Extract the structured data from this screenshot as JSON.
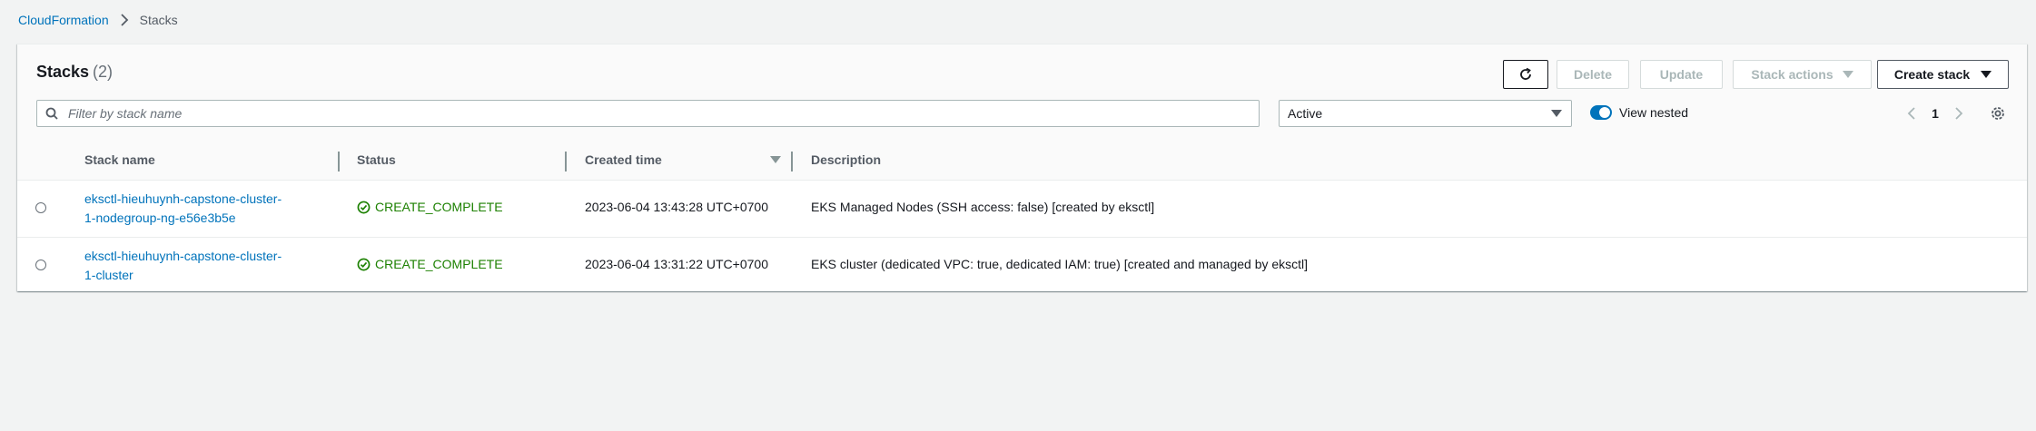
{
  "breadcrumb": {
    "root": "CloudFormation",
    "current": "Stacks"
  },
  "panel": {
    "title": "Stacks",
    "count": "(2)",
    "buttons": {
      "delete": "Delete",
      "update": "Update",
      "stack_actions": "Stack actions",
      "create_stack": "Create stack"
    },
    "search": {
      "placeholder": "Filter by stack name",
      "value": ""
    },
    "filter_select": {
      "selected": "Active"
    },
    "view_nested": {
      "label": "View nested",
      "checked": true
    },
    "pagination": {
      "current_page": "1"
    }
  },
  "table": {
    "columns": [
      "Stack name",
      "Status",
      "Created time",
      "Description"
    ],
    "sort_column": "Created time",
    "sort_direction": "descending",
    "rows": [
      {
        "name_line1": "eksctl-hieuhuynh-capstone-cluster-",
        "name_line2": "1-nodegroup-ng-e56e3b5e",
        "status": "CREATE_COMPLETE",
        "created": "2023-06-04 13:43:28 UTC+0700",
        "description": "EKS Managed Nodes (SSH access: false) [created by eksctl]"
      },
      {
        "name_line1": "eksctl-hieuhuynh-capstone-cluster-",
        "name_line2": "1-cluster",
        "status": "CREATE_COMPLETE",
        "created": "2023-06-04 13:31:22 UTC+0700",
        "description": "EKS cluster (dedicated VPC: true, dedicated IAM: true) [created and managed by eksctl]"
      }
    ]
  },
  "colors": {
    "link": "#0073bb",
    "success": "#1d8102",
    "toggle_on": "#0073bb",
    "page_bg": "#f2f3f3"
  },
  "icons": [
    "chevron-right-icon",
    "refresh-icon",
    "caret-down-icon",
    "search-icon",
    "chevron-left-icon",
    "gear-icon",
    "check-circle-icon"
  ]
}
